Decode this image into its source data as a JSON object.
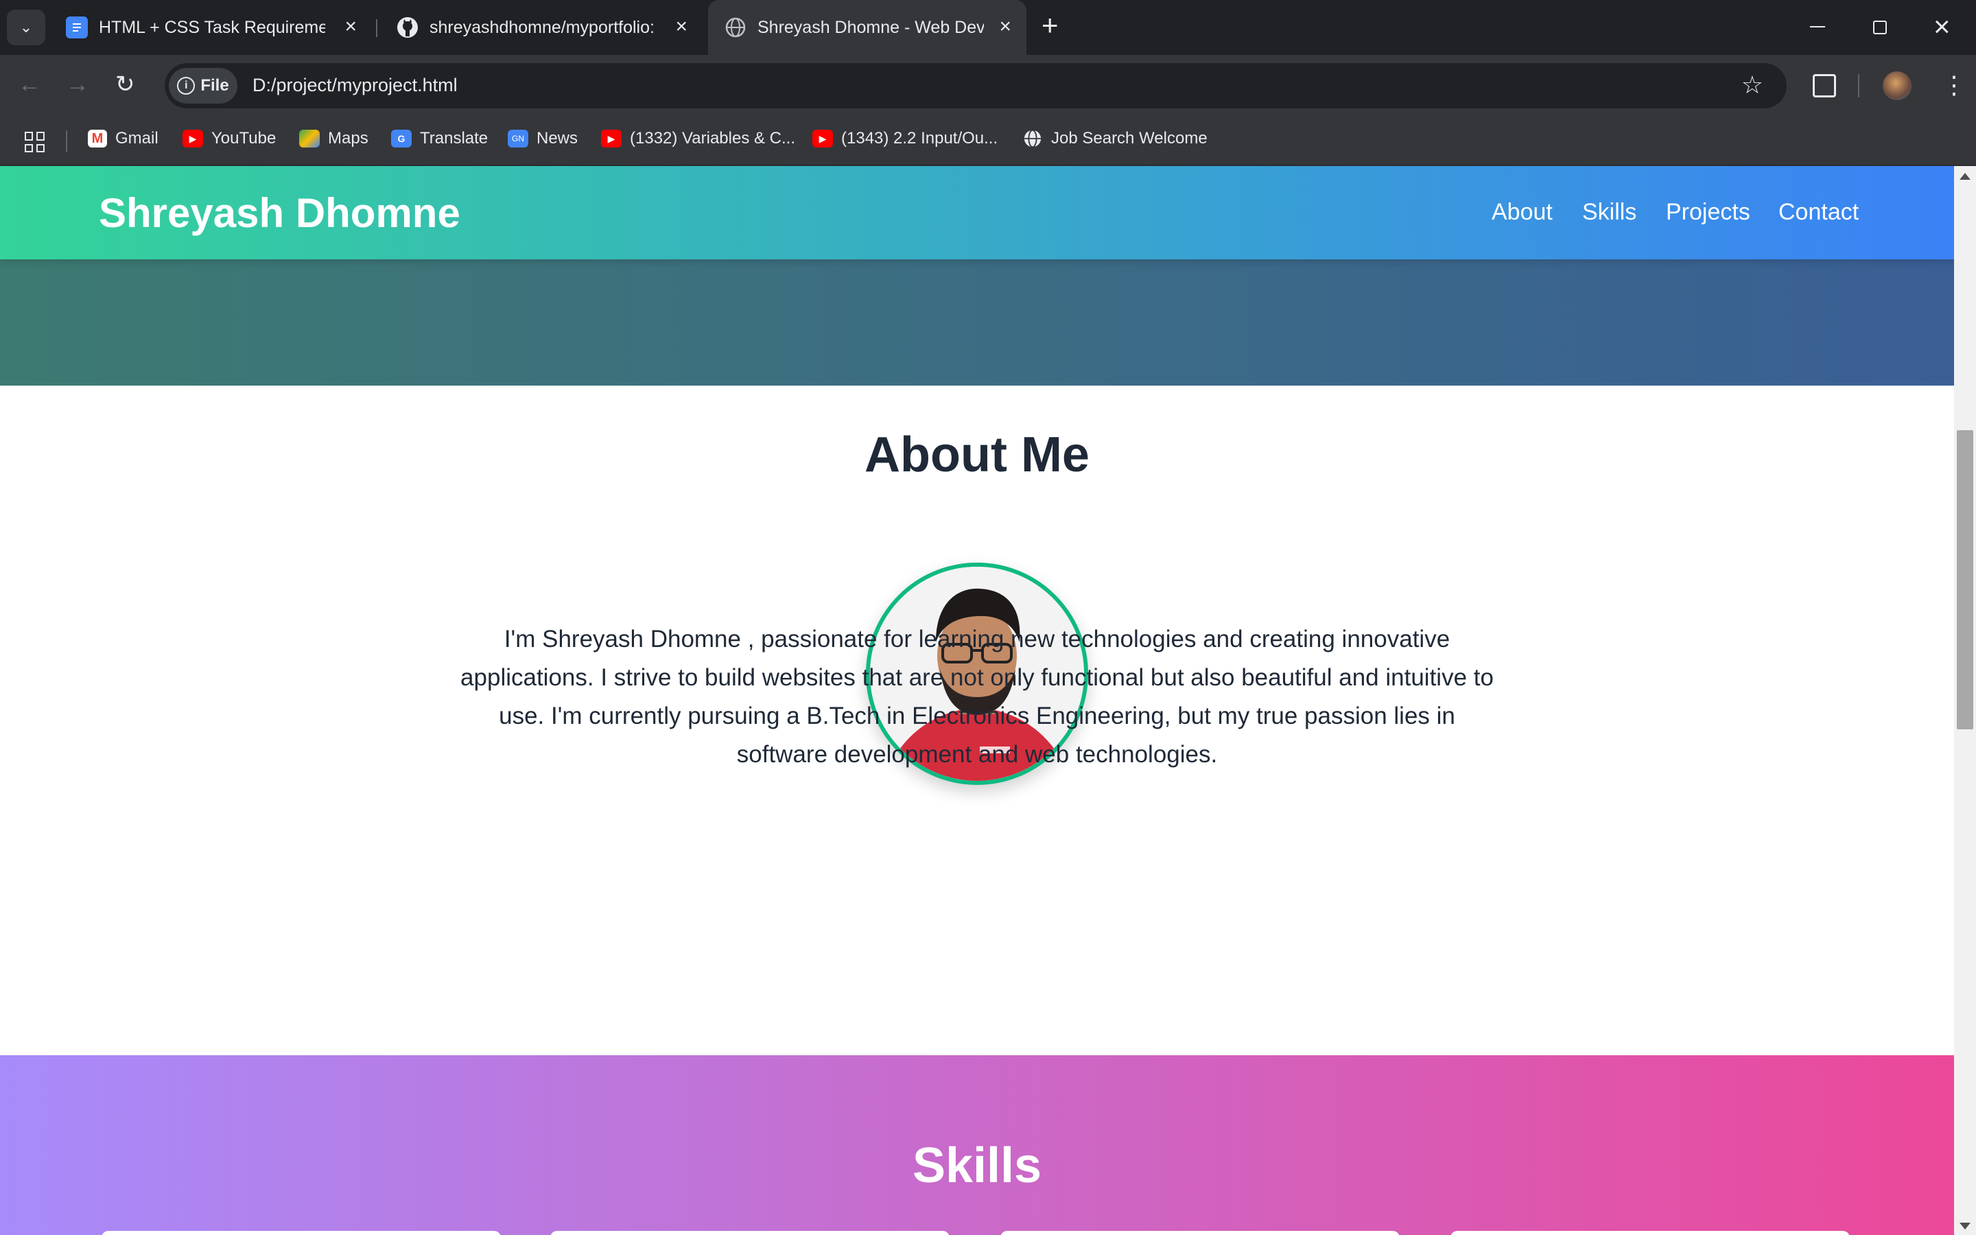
{
  "browser": {
    "tabs": [
      {
        "title": "HTML + CSS Task Requirements",
        "icon": "google-docs-icon"
      },
      {
        "title": "shreyashdhomne/myportfolio: P",
        "icon": "github-icon"
      },
      {
        "title": "Shreyash Dhomne - Web Devel",
        "icon": "globe-icon"
      }
    ],
    "new_tab": "+",
    "address": {
      "scheme_label": "File",
      "url": "D:/project/myproject.html"
    },
    "bookmarks": [
      {
        "label": "Gmail",
        "icon": "gmail-icon"
      },
      {
        "label": "YouTube",
        "icon": "youtube-icon"
      },
      {
        "label": "Maps",
        "icon": "maps-icon"
      },
      {
        "label": "Translate",
        "icon": "translate-icon"
      },
      {
        "label": "News",
        "icon": "news-icon"
      },
      {
        "label": "(1332) Variables & C...",
        "icon": "youtube-icon"
      },
      {
        "label": "(1343) 2.2 Input/Ou...",
        "icon": "youtube-icon"
      },
      {
        "label": "Job Search Welcome",
        "icon": "globe-icon"
      }
    ]
  },
  "site": {
    "brand": "Shreyash Dhomne",
    "nav": [
      "About",
      "Skills",
      "Projects",
      "Contact"
    ],
    "about": {
      "heading": "About Me",
      "paragraph": "I'm Shreyash Dhomne , passionate for learning new technologies and creating innovative applications. I strive to build websites that are not only functional but also beautiful and intuitive to use. I'm currently pursuing a B.Tech in Electronics Engineering, but my true passion lies in software development and web technologies."
    },
    "skills": {
      "heading": "Skills"
    }
  },
  "colors": {
    "nav_gradient_start": "#34d399",
    "nav_gradient_end": "#3b82f6",
    "avatar_border": "#10b981",
    "skills_gradient_start": "#a78bfa",
    "skills_gradient_end": "#ec4899",
    "heading_text": "#1f2937"
  }
}
